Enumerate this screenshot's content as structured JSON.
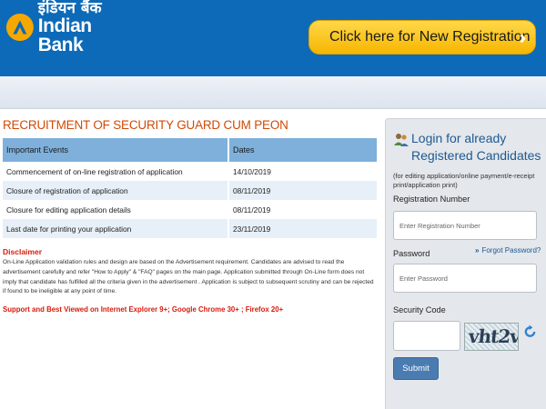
{
  "header": {
    "logo_hindi": "इंडियन बैंक",
    "logo_english": "Indian Bank",
    "registration_button": "Click here for New Registration",
    "brand_color": "#0d6ab8",
    "button_color": "#f7b500"
  },
  "main": {
    "title": "RECRUITMENT OF SECURITY GUARD CUM PEON",
    "table": {
      "headers": [
        "Important Events",
        "Dates"
      ],
      "rows": [
        [
          "Commencement of on-line registration of application",
          "14/10/2019"
        ],
        [
          "Closure of registration of application",
          "08/11/2019"
        ],
        [
          "Closure for editing application details",
          "08/11/2019"
        ],
        [
          "Last date for printing your application",
          "23/11/2019"
        ]
      ]
    },
    "disclaimer_heading": "Disclaimer",
    "disclaimer_text": "On-Line Application validation rules and design are based on the Advertisement requirement. Candidates are advised to read the advertisement carefully and refer \"How to Apply\" & \"FAQ\" pages on the main page. Application submitted through On-Line form does not imply that candidate has fulfilled all the criteria given in the advertisement . Application is subject to subsequent scrutiny and can be rejected if found to be ineligible at any point of time.",
    "support_text": "Support and Best Viewed on Internet Explorer 9+; Google Chrome 30+ ; Firefox 20+"
  },
  "login": {
    "icon": "users-icon",
    "title": "Login for already Registered Candidates",
    "note": "(for editing application/online payment/e-receipt print/application print)",
    "registration_label": "Registration Number",
    "registration_placeholder": "Enter Registration Number",
    "password_label": "Password",
    "forgot_link": "Forgot Password?",
    "password_placeholder": "Enter Password",
    "security_label": "Security Code",
    "captcha_text": "vht2v",
    "submit_label": "Submit"
  }
}
